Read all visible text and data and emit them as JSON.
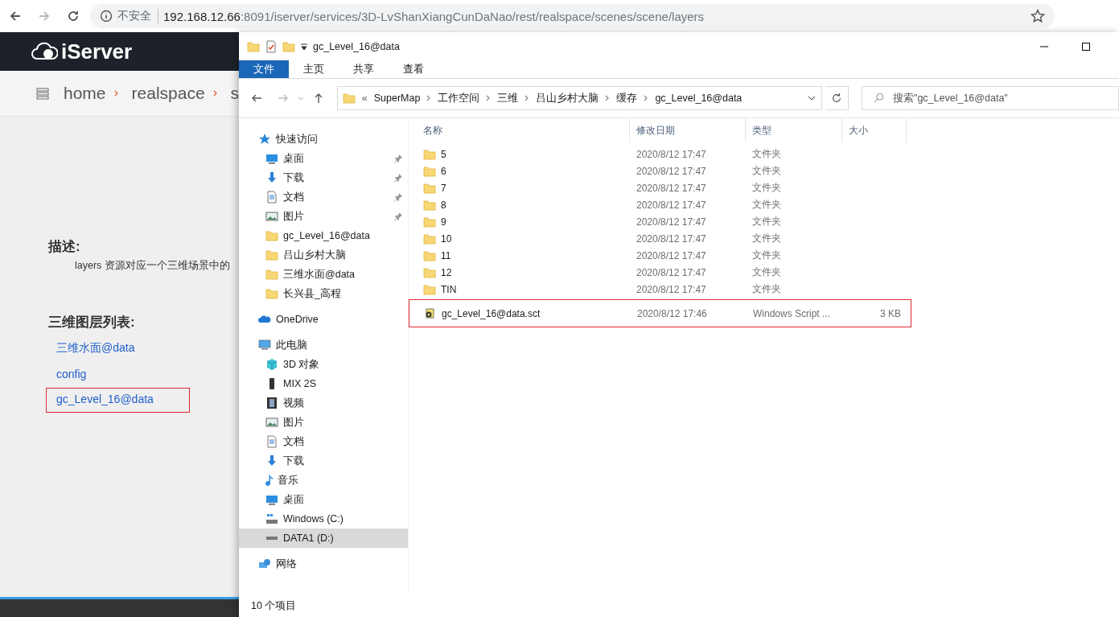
{
  "browser": {
    "security": "不安全",
    "url_host": "192.168.12.66",
    "url_path": ":8091/iserver/services/3D-LvShanXiangCunDaNao/rest/realspace/scenes/scene/layers"
  },
  "site": {
    "logo": "iServer",
    "breadcrumb": [
      "home",
      "realspace",
      "s"
    ],
    "description_heading": "描述:",
    "description": "layers 资源对应一个三维场景中的",
    "list_heading": "三维图层列表:",
    "layers": [
      {
        "name": "三维水面@data",
        "highlighted": false
      },
      {
        "name": "config",
        "highlighted": false
      },
      {
        "name": "gc_Level_16@data",
        "highlighted": true
      }
    ]
  },
  "explorer": {
    "title": "gc_Level_16@data",
    "ribbon_tabs": [
      {
        "label": "文件",
        "selected": true
      },
      {
        "label": "主页",
        "selected": false
      },
      {
        "label": "共享",
        "selected": false
      },
      {
        "label": "查看",
        "selected": false
      }
    ],
    "path_overflow": "«",
    "path": [
      "SuperMap",
      "工作空间",
      "三维",
      "吕山乡村大脑",
      "缓存",
      "gc_Level_16@data"
    ],
    "search": {
      "placeholder": "搜索\"gc_Level_16@data\""
    },
    "columns": [
      "名称",
      "修改日期",
      "类型",
      "大小"
    ],
    "nav": [
      {
        "label": "快速访问",
        "kind": "star",
        "selected": false,
        "children": [
          {
            "label": "桌面",
            "kind": "desktop",
            "pinned": true,
            "selected": false
          },
          {
            "label": "下载",
            "kind": "download",
            "pinned": true,
            "selected": false
          },
          {
            "label": "文档",
            "kind": "document",
            "pinned": true,
            "selected": false
          },
          {
            "label": "图片",
            "kind": "picture",
            "pinned": true,
            "selected": false
          },
          {
            "label": "gc_Level_16@data",
            "kind": "folder",
            "pinned": false,
            "selected": false
          },
          {
            "label": "吕山乡村大脑",
            "kind": "folder",
            "pinned": false,
            "selected": false
          },
          {
            "label": "三维水面@data",
            "kind": "folder",
            "pinned": false,
            "selected": false
          },
          {
            "label": "长兴县_高程",
            "kind": "folder",
            "pinned": false,
            "selected": false
          }
        ]
      },
      {
        "label": "OneDrive",
        "kind": "cloud",
        "selected": false
      },
      {
        "label": "此电脑",
        "kind": "pc",
        "selected": false,
        "children": [
          {
            "label": "3D 对象",
            "kind": "cube",
            "pinned": false,
            "selected": false
          },
          {
            "label": "MIX 2S",
            "kind": "phone",
            "pinned": false,
            "selected": false
          },
          {
            "label": "视频",
            "kind": "video",
            "pinned": false,
            "selected": false
          },
          {
            "label": "图片",
            "kind": "picture",
            "pinned": false,
            "selected": false
          },
          {
            "label": "文档",
            "kind": "document",
            "pinned": false,
            "selected": false
          },
          {
            "label": "下载",
            "kind": "download",
            "pinned": false,
            "selected": false
          },
          {
            "label": "音乐",
            "kind": "music",
            "pinned": false,
            "selected": false
          },
          {
            "label": "桌面",
            "kind": "desktop",
            "pinned": false,
            "selected": false
          },
          {
            "label": "Windows (C:)",
            "kind": "system-drive",
            "pinned": false,
            "selected": false
          },
          {
            "label": "DATA1 (D:)",
            "kind": "drive",
            "pinned": false,
            "selected": true
          }
        ]
      },
      {
        "label": "网络",
        "kind": "network",
        "selected": false
      }
    ],
    "files": [
      {
        "name": "5",
        "modified": "2020/8/12 17:47",
        "type": "文件夹",
        "kind": "folder",
        "highlighted": false
      },
      {
        "name": "6",
        "modified": "2020/8/12 17:47",
        "type": "文件夹",
        "kind": "folder",
        "highlighted": false
      },
      {
        "name": "7",
        "modified": "2020/8/12 17:47",
        "type": "文件夹",
        "kind": "folder",
        "highlighted": false
      },
      {
        "name": "8",
        "modified": "2020/8/12 17:47",
        "type": "文件夹",
        "kind": "folder",
        "highlighted": false
      },
      {
        "name": "9",
        "modified": "2020/8/12 17:47",
        "type": "文件夹",
        "kind": "folder",
        "highlighted": false
      },
      {
        "name": "10",
        "modified": "2020/8/12 17:47",
        "type": "文件夹",
        "kind": "folder",
        "highlighted": false
      },
      {
        "name": "11",
        "modified": "2020/8/12 17:47",
        "type": "文件夹",
        "kind": "folder",
        "highlighted": false
      },
      {
        "name": "12",
        "modified": "2020/8/12 17:47",
        "type": "文件夹",
        "kind": "folder",
        "highlighted": false
      },
      {
        "name": "TIN",
        "modified": "2020/8/12 17:47",
        "type": "文件夹",
        "kind": "folder",
        "highlighted": false
      },
      {
        "name": "gc_Level_16@data.sct",
        "modified": "2020/8/12 17:46",
        "type": "Windows Script ...",
        "size": "3 KB",
        "kind": "script",
        "highlighted": true
      }
    ],
    "status": "10 个项目"
  }
}
